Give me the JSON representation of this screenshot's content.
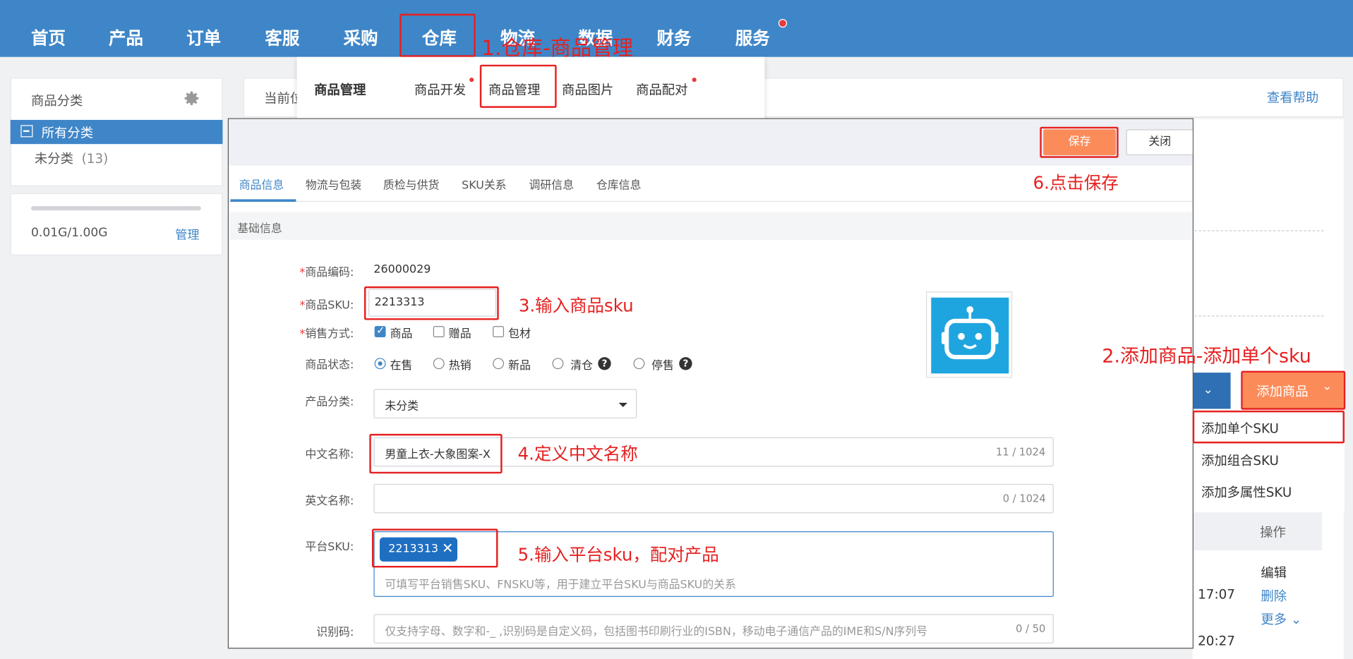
{
  "nav": {
    "items": [
      "首页",
      "产品",
      "订单",
      "客服",
      "采购",
      "仓库",
      "物流",
      "数据",
      "财务",
      "服务"
    ]
  },
  "sidebar": {
    "title": "商品分类",
    "all_category": "所有分类",
    "uncategorized": "未分类",
    "uncategorized_count": "(13)",
    "storage": "0.01G/1.00G",
    "manage": "管理"
  },
  "main": {
    "current_label": "当前位",
    "help": "查看帮助"
  },
  "submenu": {
    "heading": "商品管理",
    "items": [
      "商品开发",
      "商品管理",
      "商品图片",
      "商品配对"
    ]
  },
  "modal": {
    "save": "保存",
    "close": "关闭",
    "tabs": [
      "商品信息",
      "物流与包装",
      "质检与供货",
      "SKU关系",
      "调研信息",
      "仓库信息"
    ],
    "section": "基础信息",
    "fields": {
      "code_label": "商品编码:",
      "code_value": "26000029",
      "sku_label": "商品SKU:",
      "sku_value": "2213313",
      "sale_label": "销售方式:",
      "sale_options": [
        "商品",
        "赠品",
        "包材"
      ],
      "status_label": "商品状态:",
      "status_options": [
        "在售",
        "热销",
        "新品",
        "清仓",
        "停售"
      ],
      "category_label": "产品分类:",
      "category_value": "未分类",
      "cn_name_label": "中文名称:",
      "cn_name_value": "男童上衣-大象图案-X",
      "cn_name_counter": "11 / 1024",
      "en_name_label": "英文名称:",
      "en_name_counter": "0 / 1024",
      "platform_sku_label": "平台SKU:",
      "platform_sku_tag": "2213313",
      "platform_sku_placeholder": "可填写平台销售SKU、FNSKU等，用于建立平台SKU与商品SKU的关系",
      "id_code_label": "识别码:",
      "id_code_placeholder": "仅支持字母、数字和-_ ,识别码是自定义码，包括图书印刷行业的ISBN，移动电子通信产品的IME和S/N序列号",
      "id_code_counter": "0 / 50"
    }
  },
  "right": {
    "add_product": "添加商品",
    "dropdown": [
      "添加单个SKU",
      "添加组合SKU",
      "添加多属性SKU"
    ],
    "op_header": "操作",
    "ops": [
      "编辑",
      "删除",
      "更多"
    ],
    "times": [
      "17:07",
      "20:27"
    ]
  },
  "annotations": [
    "1.仓库-商品管理",
    "2.添加商品-添加单个sku",
    "3.输入商品sku",
    "4.定义中文名称",
    "5.输入平台sku，配对产品",
    "6.点击保存"
  ]
}
